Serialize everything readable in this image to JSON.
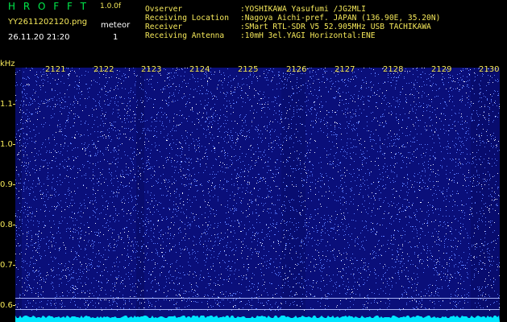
{
  "header": {
    "software_name": "H R O F F T",
    "version": "1.0.0f",
    "filename": "YY2611202120.png",
    "datetime": "26.11.20 21:20",
    "meteor_label": "meteor",
    "meteor_count": "1"
  },
  "info": [
    {
      "key": "Ovserver",
      "value": ":YOSHIKAWA Yasufumi /JG2MLI"
    },
    {
      "key": "Receiving Location",
      "value": ":Nagoya Aichi-pref. JAPAN (136.90E, 35.20N)"
    },
    {
      "key": "Receiver",
      "value": ":SMart RTL-SDR V5 52.905MHz USB TACHIKAWA"
    },
    {
      "key": "Receiving Antenna",
      "value": ":10mH 3el.YAGI Horizontal:ENE"
    }
  ],
  "axis": {
    "y_unit": "kHz",
    "y_ticks": [
      "1.1",
      "1.0",
      "0.9",
      "0.8",
      "0.7",
      "0.6"
    ],
    "x_ticks": [
      "2121",
      "2122",
      "2123",
      "2124",
      "2125",
      "2126",
      "2127",
      "2128",
      "2129",
      "2130"
    ]
  },
  "colors": {
    "background": "#0a0f7a",
    "noise": "#5a7cff",
    "bright": "#ffffff",
    "text_green": "#00e84a",
    "text_yellow": "#f5e85a",
    "baseline": "#00e5ff"
  }
}
